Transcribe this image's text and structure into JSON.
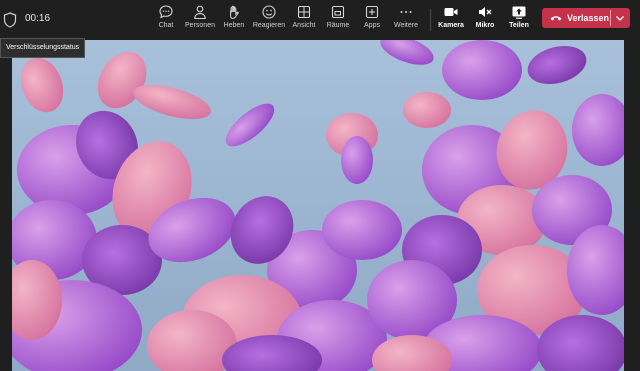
{
  "header": {
    "timer": "00:16",
    "tooltip": "Verschlüsselungsstatus"
  },
  "toolbar": {
    "chat": "Chat",
    "people": "Personen",
    "raise": "Heben",
    "react": "Reagieren",
    "view": "Ansicht",
    "rooms": "Räume",
    "apps": "Apps",
    "more": "Weitere",
    "camera": "Kamera",
    "mic": "Mikro",
    "share": "Teilen",
    "leave": "Verlassen"
  },
  "colors": {
    "leave_button": "#c4314b",
    "background": "#1f1f1f"
  }
}
